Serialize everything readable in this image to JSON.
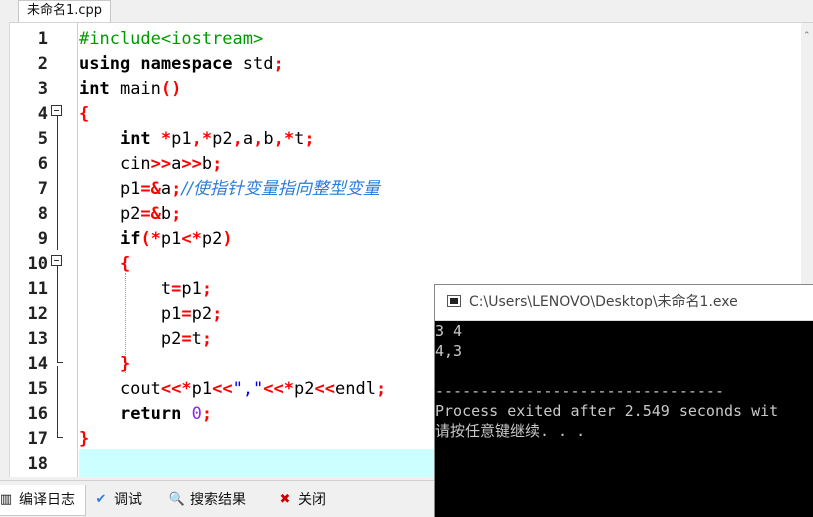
{
  "tab": {
    "filename": "未命名1.cpp"
  },
  "editor": {
    "line_numbers": [
      "1",
      "2",
      "3",
      "4",
      "5",
      "6",
      "7",
      "8",
      "9",
      "10",
      "11",
      "12",
      "13",
      "14",
      "15",
      "16",
      "17",
      "18"
    ],
    "lines": [
      [
        {
          "c": "pp",
          "t": "#include<iostream>"
        }
      ],
      [
        {
          "c": "kw",
          "t": "using namespace "
        },
        {
          "c": "id",
          "t": "std"
        },
        {
          "c": "op",
          "t": ";"
        }
      ],
      [
        {
          "c": "kw",
          "t": "int "
        },
        {
          "c": "id",
          "t": "main"
        },
        {
          "c": "op",
          "t": "()"
        }
      ],
      [
        {
          "c": "op",
          "t": "{"
        }
      ],
      [
        {
          "c": "id",
          "t": "    "
        },
        {
          "c": "kw",
          "t": "int "
        },
        {
          "c": "op",
          "t": "*"
        },
        {
          "c": "id",
          "t": "p1"
        },
        {
          "c": "op",
          "t": ",*"
        },
        {
          "c": "id",
          "t": "p2"
        },
        {
          "c": "op",
          "t": ","
        },
        {
          "c": "id",
          "t": "a"
        },
        {
          "c": "op",
          "t": ","
        },
        {
          "c": "id",
          "t": "b"
        },
        {
          "c": "op",
          "t": ",*"
        },
        {
          "c": "id",
          "t": "t"
        },
        {
          "c": "op",
          "t": ";"
        }
      ],
      [
        {
          "c": "id",
          "t": "    cin"
        },
        {
          "c": "op",
          "t": ">>"
        },
        {
          "c": "id",
          "t": "a"
        },
        {
          "c": "op",
          "t": ">>"
        },
        {
          "c": "id",
          "t": "b"
        },
        {
          "c": "op",
          "t": ";"
        }
      ],
      [
        {
          "c": "id",
          "t": "    p1"
        },
        {
          "c": "op",
          "t": "=&"
        },
        {
          "c": "id",
          "t": "a"
        },
        {
          "c": "op",
          "t": ";"
        },
        {
          "c": "cm",
          "t": "//使指针变量指向整型变量"
        }
      ],
      [
        {
          "c": "id",
          "t": "    p2"
        },
        {
          "c": "op",
          "t": "=&"
        },
        {
          "c": "id",
          "t": "b"
        },
        {
          "c": "op",
          "t": ";"
        }
      ],
      [
        {
          "c": "id",
          "t": "    "
        },
        {
          "c": "kw",
          "t": "if"
        },
        {
          "c": "op",
          "t": "(*"
        },
        {
          "c": "id",
          "t": "p1"
        },
        {
          "c": "op",
          "t": "<*"
        },
        {
          "c": "id",
          "t": "p2"
        },
        {
          "c": "op",
          "t": ")"
        }
      ],
      [
        {
          "c": "id",
          "t": "    "
        },
        {
          "c": "op",
          "t": "{"
        }
      ],
      [
        {
          "c": "id",
          "t": "        t"
        },
        {
          "c": "op",
          "t": "="
        },
        {
          "c": "id",
          "t": "p1"
        },
        {
          "c": "op",
          "t": ";"
        }
      ],
      [
        {
          "c": "id",
          "t": "        p1"
        },
        {
          "c": "op",
          "t": "="
        },
        {
          "c": "id",
          "t": "p2"
        },
        {
          "c": "op",
          "t": ";"
        }
      ],
      [
        {
          "c": "id",
          "t": "        p2"
        },
        {
          "c": "op",
          "t": "="
        },
        {
          "c": "id",
          "t": "t"
        },
        {
          "c": "op",
          "t": ";"
        }
      ],
      [
        {
          "c": "id",
          "t": "    "
        },
        {
          "c": "op",
          "t": "}"
        }
      ],
      [
        {
          "c": "id",
          "t": "    cout"
        },
        {
          "c": "op",
          "t": "<<*"
        },
        {
          "c": "id",
          "t": "p1"
        },
        {
          "c": "op",
          "t": "<<"
        },
        {
          "c": "st",
          "t": "\",\""
        },
        {
          "c": "op",
          "t": "<<*"
        },
        {
          "c": "id",
          "t": "p2"
        },
        {
          "c": "op",
          "t": "<<"
        },
        {
          "c": "id",
          "t": "endl"
        },
        {
          "c": "op",
          "t": ";"
        }
      ],
      [
        {
          "c": "id",
          "t": "    "
        },
        {
          "c": "kw",
          "t": "return "
        },
        {
          "c": "nm",
          "t": "0"
        },
        {
          "c": "op",
          "t": ";"
        }
      ],
      [
        {
          "c": "op",
          "t": "}"
        }
      ],
      []
    ]
  },
  "bottom_tabs": [
    {
      "label": "编译日志",
      "icon": "compile-log-icon",
      "glyph": "▥"
    },
    {
      "label": "调试",
      "icon": "debug-check-icon",
      "glyph": "✔"
    },
    {
      "label": "搜索结果",
      "icon": "search-results-icon",
      "glyph": "🔍"
    },
    {
      "label": "关闭",
      "icon": "close-panel-icon",
      "glyph": "✖"
    }
  ],
  "console": {
    "title": "C:\\Users\\LENOVO\\Desktop\\未命名1.exe",
    "output_lines": [
      "3 4",
      "4,3",
      "",
      "--------------------------------",
      "Process exited after 2.549 seconds wit",
      "请按任意键继续. . ."
    ]
  },
  "colors": {
    "keyword": "#000000",
    "operator": "#ff0000",
    "preprocessor": "#009a00",
    "comment": "#2a7dd8",
    "string": "#0000ff",
    "number": "#8a2be2",
    "current_line": "#ccffff"
  }
}
